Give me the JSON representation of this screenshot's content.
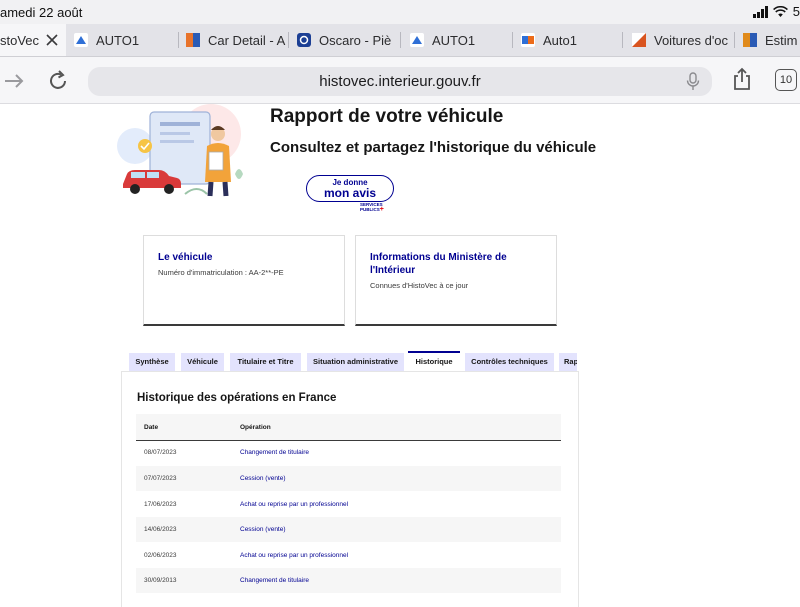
{
  "status_bar": {
    "time": "amedi 22 août",
    "battery": "5"
  },
  "browser": {
    "tabs": [
      {
        "label": "stoVec",
        "active": true,
        "favicon_color": "#ffffff"
      },
      {
        "label": "AUTO1",
        "favicon_color": "#2f6fd6"
      },
      {
        "label": "Car Detail - A",
        "favicon_color": "#e8732b"
      },
      {
        "label": "Oscaro - Piè",
        "favicon_color": "#1c3f94"
      },
      {
        "label": "AUTO1",
        "favicon_color": "#2f6fd6"
      },
      {
        "label": "Auto1",
        "favicon_color": "#ec6b1a"
      },
      {
        "label": "Voitures d'oc",
        "favicon_color": "#d9541f"
      },
      {
        "label": "Estim",
        "favicon_color": "#e08a1b"
      }
    ],
    "url": "histovec.interieur.gouv.fr",
    "tab_count": "10",
    "icons": [
      "close-icon",
      "forward-icon",
      "reload-icon",
      "microphone-icon",
      "share-icon",
      "tabs-icon"
    ]
  },
  "hero": {
    "title": "Rapport de votre véhicule",
    "subtitle": "Consultez et partagez l'historique du véhicule",
    "avis_button": {
      "line1": "Je donne",
      "line2": "mon avis"
    },
    "services_publics": {
      "line1": "SERVICES",
      "line2": "PUBLICS"
    }
  },
  "cards": [
    {
      "title": "Le véhicule",
      "description": "Numéro d'immatriculation : AA-2**-PE"
    },
    {
      "title_line1": "Informations du Ministère de",
      "title_line2": "l'Intérieur",
      "description": "Connues d'HistoVec à ce jour"
    }
  ],
  "report_tabs": [
    {
      "label": "Synthèse"
    },
    {
      "label": "Véhicule"
    },
    {
      "label": "Titulaire et Titre"
    },
    {
      "label": "Situation administrative"
    },
    {
      "label": "Historique",
      "active": true
    },
    {
      "label": "Contrôles techniques"
    },
    {
      "label": "Rap"
    }
  ],
  "history": {
    "title": "Historique des opérations en France",
    "columns": {
      "date": "Date",
      "operation": "Opération"
    },
    "rows": [
      {
        "date": "08/07/2023",
        "operation": "Changement de titulaire"
      },
      {
        "date": "07/07/2023",
        "operation": "Cession (vente)"
      },
      {
        "date": "17/06/2023",
        "operation": "Achat ou reprise par un professionnel"
      },
      {
        "date": "14/06/2023",
        "operation": "Cession (vente)"
      },
      {
        "date": "02/06/2023",
        "operation": "Achat ou reprise par un professionnel"
      },
      {
        "date": "30/09/2013",
        "operation": "Changement de titulaire"
      }
    ]
  },
  "colors": {
    "brand_blue": "#000091",
    "tab_inactive": "#e3e3fd"
  }
}
